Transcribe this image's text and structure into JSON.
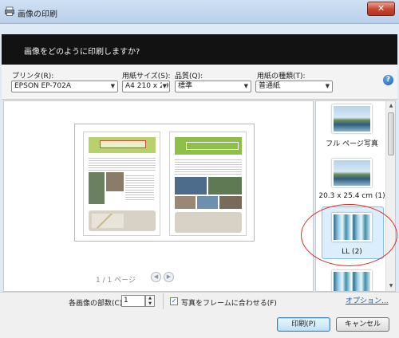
{
  "window": {
    "title": "画像の印刷",
    "close_symbol": "✕"
  },
  "header": {
    "question": "画像をどのように印刷しますか?"
  },
  "options": {
    "printer": {
      "label": "プリンタ(R):",
      "value": "EPSON EP-702A"
    },
    "paper_size": {
      "label": "用紙サイズ(S):",
      "value": "A4 210 x 29"
    },
    "quality": {
      "label": "品質(Q):",
      "value": "標準"
    },
    "paper_type": {
      "label": "用紙の種類(T):",
      "value": "普通紙"
    },
    "help_symbol": "?"
  },
  "preview": {
    "page_counter": "1 / 1 ページ",
    "prev_symbol": "◀",
    "next_symbol": "▶"
  },
  "layouts": [
    {
      "label": "フル ページ写真",
      "selected": false
    },
    {
      "label": "20.3 x 25.4 cm (1)",
      "selected": false
    },
    {
      "label": "LL (2)",
      "selected": true
    },
    {
      "label": "",
      "selected": false
    }
  ],
  "bottom": {
    "copies_label": "各画像の部数(C):",
    "copies_value": "1",
    "fit_checkbox_label": "写真をフレームに合わせる(F)",
    "fit_checked": true,
    "check_symbol": "✓",
    "options_link": "オプション...",
    "print_button": "印刷(P)",
    "cancel_button": "キャンセル"
  },
  "colors": {
    "highlight_ellipse": "#e12828",
    "header_bg": "#121212",
    "link": "#1a5fb4"
  }
}
